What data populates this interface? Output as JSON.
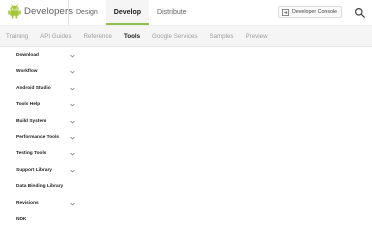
{
  "header": {
    "brand": "Developers",
    "main_nav": [
      {
        "label": "Design",
        "active": false
      },
      {
        "label": "Develop",
        "active": true
      },
      {
        "label": "Distribute",
        "active": false
      }
    ],
    "console_button": "Developer Console",
    "accent_color": "#8bc34a",
    "logo_color": "#a4c639"
  },
  "sub_nav": [
    {
      "label": "Training",
      "active": false
    },
    {
      "label": "API Guides",
      "active": false
    },
    {
      "label": "Reference",
      "active": false
    },
    {
      "label": "Tools",
      "active": true
    },
    {
      "label": "Google Services",
      "active": false
    },
    {
      "label": "Samples",
      "active": false
    },
    {
      "label": "Preview",
      "active": false
    }
  ],
  "sidebar": {
    "items": [
      {
        "label": "Download",
        "expandable": true
      },
      {
        "label": "Workflow",
        "expandable": true
      },
      {
        "label": "Android Studio",
        "expandable": true
      },
      {
        "label": "Tools Help",
        "expandable": true
      },
      {
        "label": "Build System",
        "expandable": true
      },
      {
        "label": "Performance Tools",
        "expandable": true
      },
      {
        "label": "Testing Tools",
        "expandable": true
      },
      {
        "label": "Support Library",
        "expandable": true
      },
      {
        "label": "Data Binding Library",
        "expandable": false
      },
      {
        "label": "Revisions",
        "expandable": true
      },
      {
        "label": "NDK",
        "expandable": false
      }
    ]
  }
}
